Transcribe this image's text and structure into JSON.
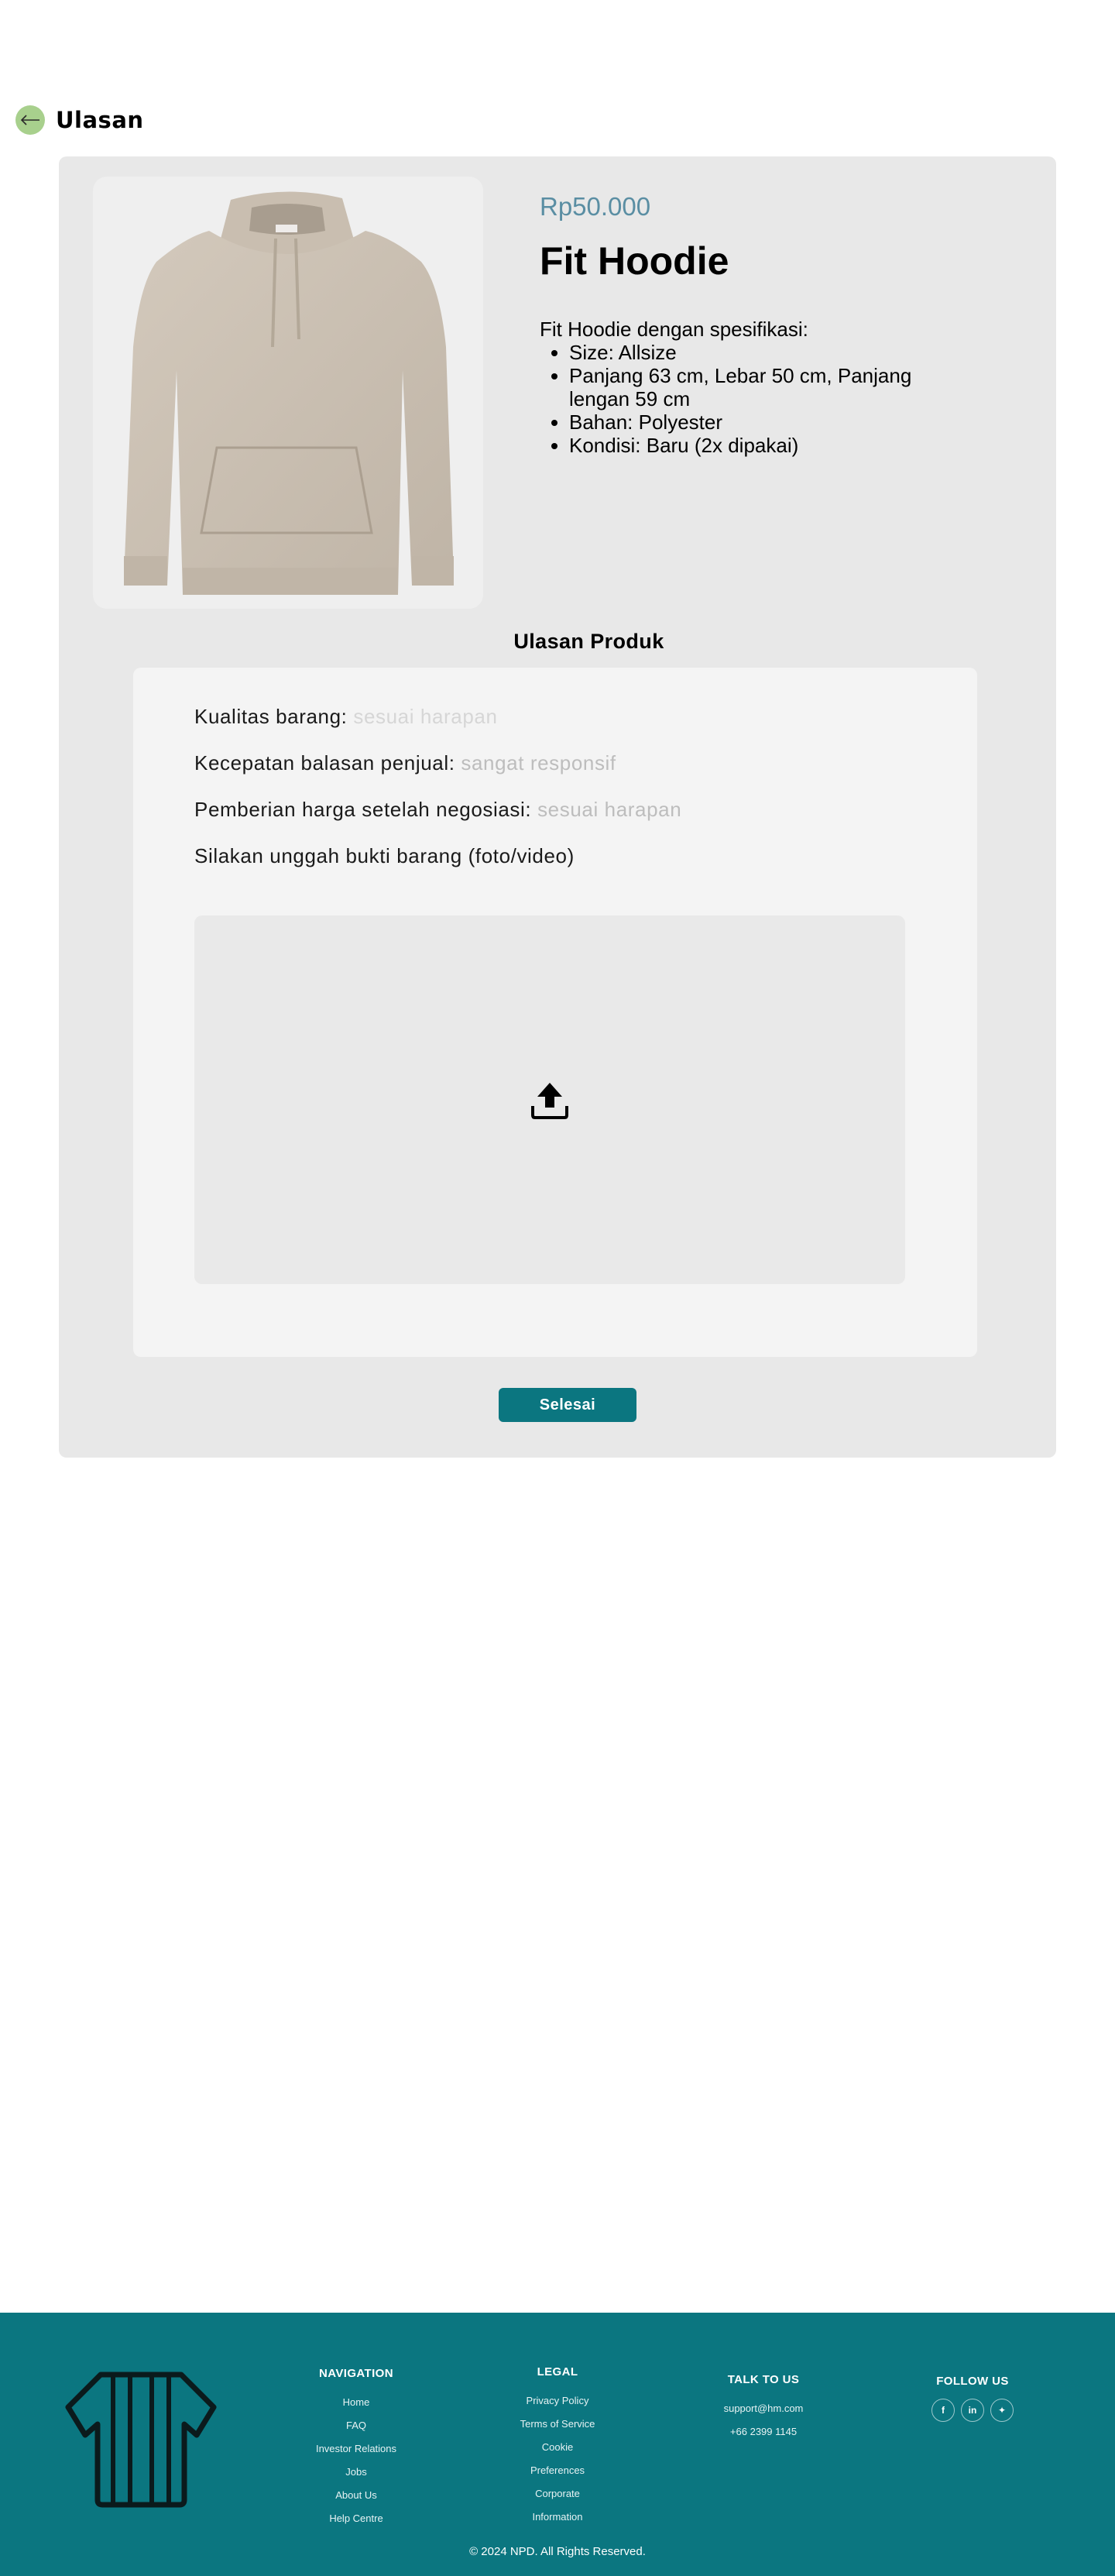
{
  "header": {
    "title": "Ulasan",
    "back_icon": "arrow-left-icon"
  },
  "product": {
    "price": "Rp50.000",
    "name": "Fit Hoodie",
    "description_intro": "Fit Hoodie dengan spesifikasi:",
    "specs": [
      "Size: Allsize",
      "Panjang 63 cm, Lebar 50 cm, Panjang lengan 59 cm",
      "Bahan: Polyester",
      "Kondisi: Baru (2x dipakai)"
    ]
  },
  "review": {
    "heading": "Ulasan Produk",
    "quality_label": "Kualitas barang:",
    "quality_value": "sesuai harapan",
    "speed_label": "Kecepatan balasan penjual:",
    "speed_value": "sangat responsif",
    "price_label": "Pemberian harga setelah negosiasi:",
    "price_value": "sesuai harapan",
    "upload_label": "Silakan unggah bukti barang (foto/video)",
    "upload_icon": "upload-icon",
    "submit_label": "Selesai"
  },
  "footer": {
    "navigation": {
      "title": "NAVIGATION",
      "links": [
        "Home",
        "FAQ",
        "Investor Relations",
        "Jobs",
        "About Us",
        "Help Centre"
      ]
    },
    "legal": {
      "title": "LEGAL",
      "links": [
        "Privacy Policy",
        "Terms of Service",
        "Cookie",
        "Preferences",
        "Corporate",
        "Information"
      ]
    },
    "talk": {
      "title": "TALK TO US",
      "email": "support@hm.com",
      "phone": "+66 2399 1145"
    },
    "follow": {
      "title": "FOLLOW US",
      "icons": [
        "facebook-icon",
        "linkedin-icon",
        "twitter-icon"
      ],
      "glyphs": [
        "f",
        "in",
        "✦"
      ]
    },
    "copyright": "© 2024 NPD. All Rights Reserved."
  },
  "colors": {
    "accent": "#0b7680",
    "price": "#5a8ea3",
    "back_button": "#a8d08d",
    "card_bg": "#e8e8e8"
  }
}
